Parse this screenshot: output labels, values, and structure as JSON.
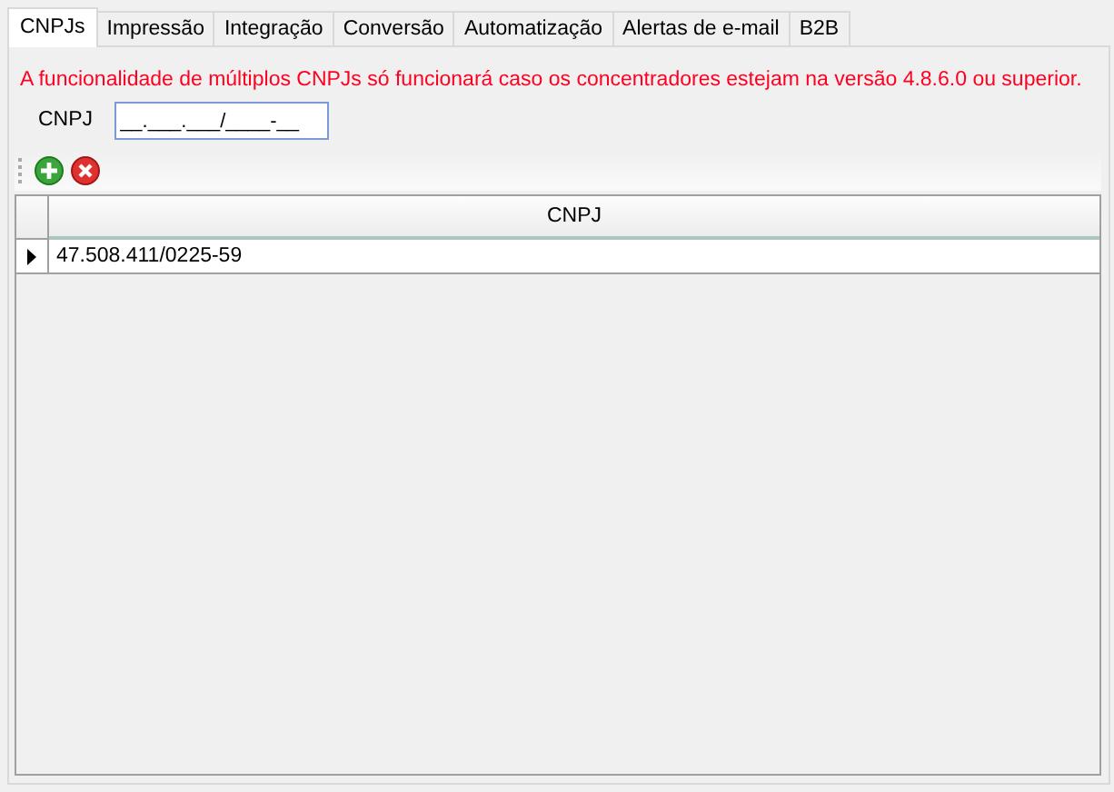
{
  "tabs": [
    {
      "label": "CNPJs",
      "selected": true
    },
    {
      "label": "Impressão",
      "selected": false
    },
    {
      "label": "Integração",
      "selected": false
    },
    {
      "label": "Conversão",
      "selected": false
    },
    {
      "label": "Automatização",
      "selected": false
    },
    {
      "label": "Alertas de e-mail",
      "selected": false
    },
    {
      "label": "B2B",
      "selected": false
    }
  ],
  "warning": "A funcionalidade de múltiplos CNPJs só funcionará caso os concentradores estejam na versão 4.8.6.0 ou superior.",
  "cnpj_field": {
    "label": "CNPJ",
    "value": "__.___.___/____-__"
  },
  "table": {
    "columns": [
      "CNPJ"
    ],
    "rows": [
      {
        "cells": [
          "47.508.411/0225-59"
        ],
        "selected": true
      }
    ]
  }
}
